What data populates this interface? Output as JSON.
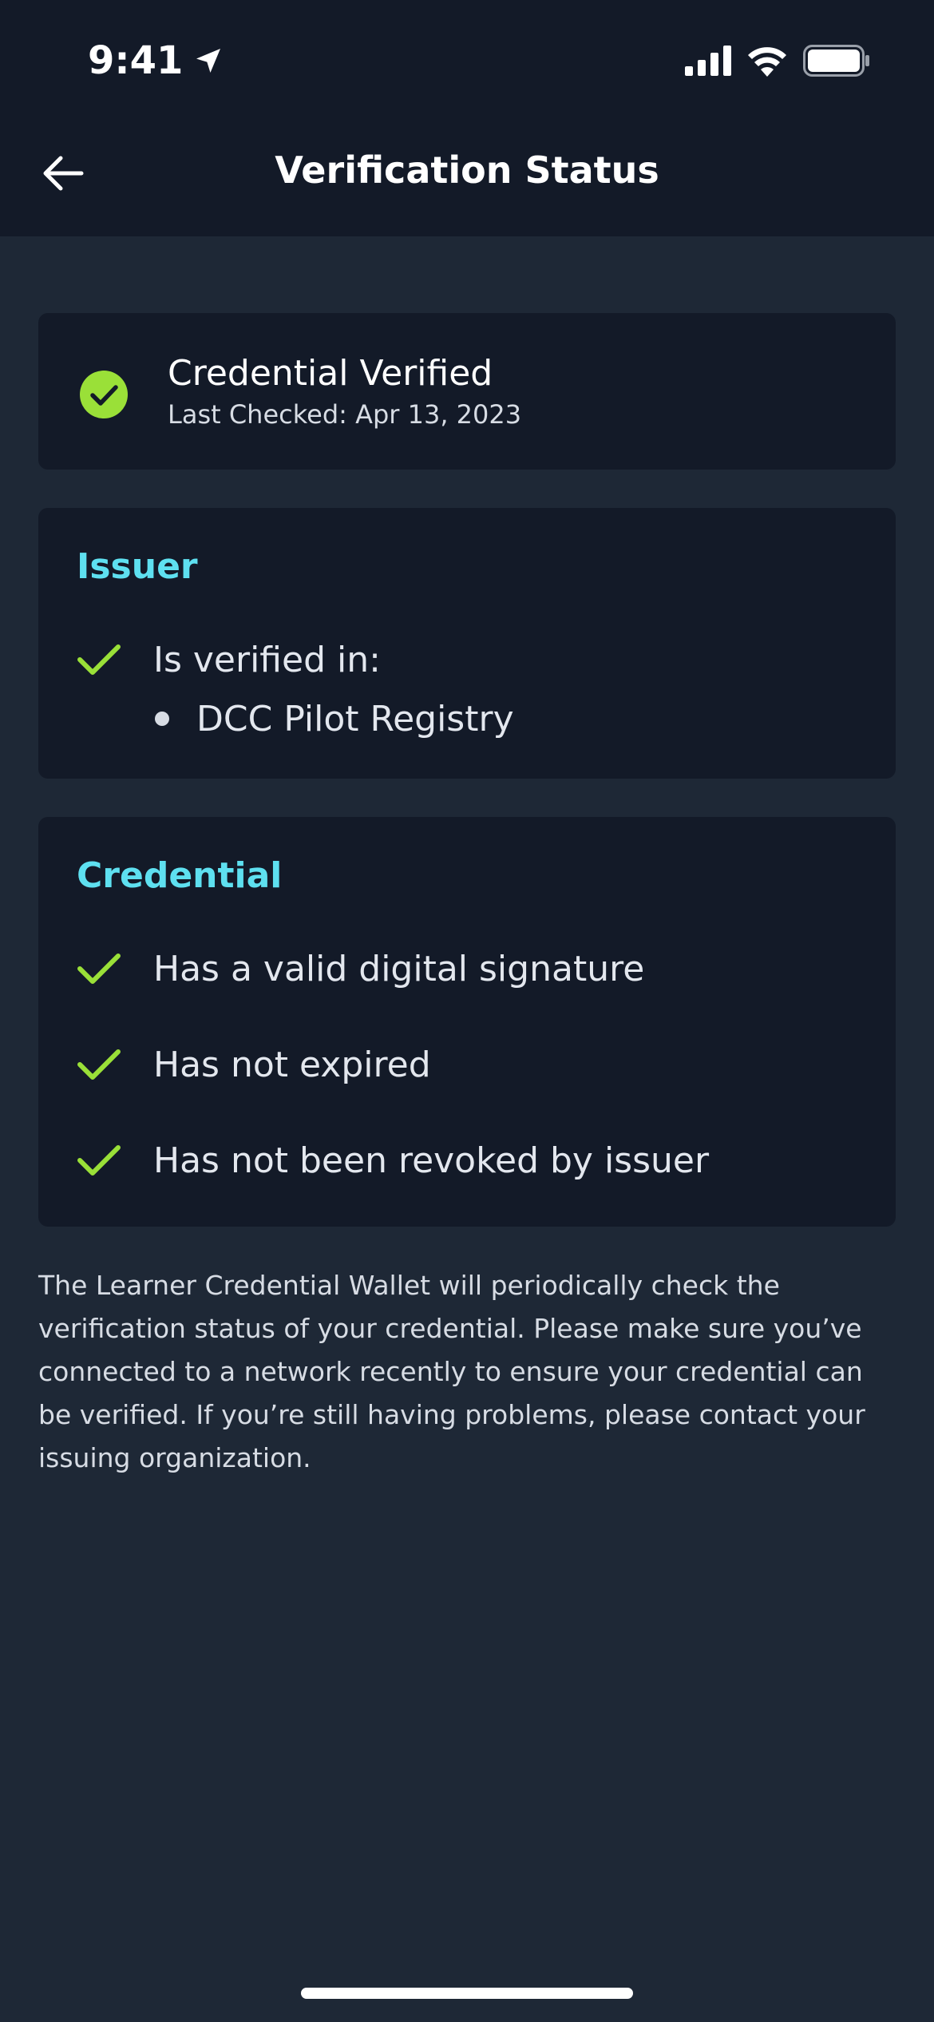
{
  "status_bar": {
    "time": "9:41",
    "icons": [
      "location-arrow-icon",
      "cellular-signal-icon",
      "wifi-icon",
      "battery-icon"
    ]
  },
  "header": {
    "title": "Verification Status",
    "back_icon": "arrow-left-icon"
  },
  "status_card": {
    "icon": "check-circle-icon",
    "title": "Credential Verified",
    "subtitle": "Last Checked: Apr 13, 2023"
  },
  "issuer_card": {
    "heading": "Issuer",
    "items": [
      {
        "icon": "checkmark-icon",
        "label": "Is verified in:"
      }
    ],
    "registries": [
      "DCC Pilot Registry"
    ]
  },
  "credential_card": {
    "heading": "Credential",
    "items": [
      {
        "icon": "checkmark-icon",
        "label": "Has a valid digital signature"
      },
      {
        "icon": "checkmark-icon",
        "label": "Has not expired"
      },
      {
        "icon": "checkmark-icon",
        "label": "Has not been revoked by issuer"
      }
    ]
  },
  "info_text": "The Learner Credential Wallet will periodically check the verification status of your credential. Please make sure you’ve connected to a network recently to ensure your credential can be verified. If you’re still having problems, please contact your issuing organization.",
  "colors": {
    "background": "#1e2836",
    "card": "#131a28",
    "accent_heading": "#5ee0f0",
    "success": "#9ae038"
  }
}
